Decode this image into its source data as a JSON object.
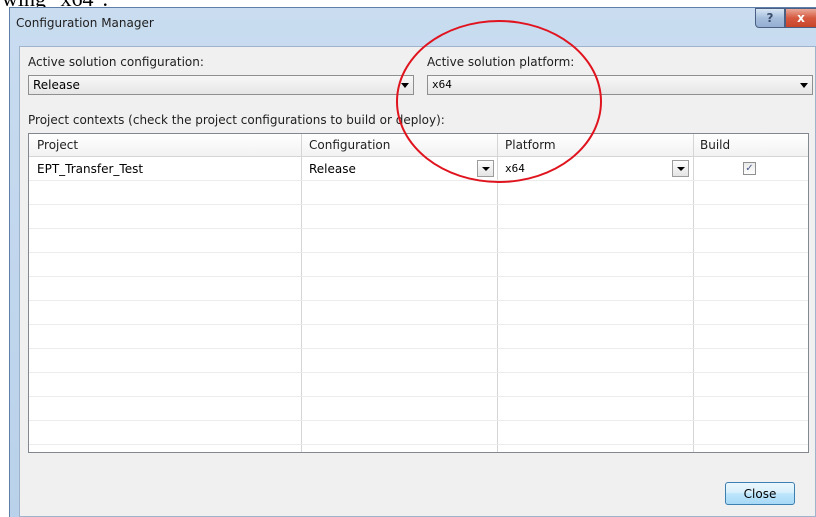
{
  "page_text": "wing \"x64\".",
  "window": {
    "title": "Configuration Manager",
    "help_glyph": "?",
    "close_glyph": "x"
  },
  "active_config": {
    "label": "Active solution configuration:",
    "value": "Release"
  },
  "active_platform": {
    "label": "Active solution platform:",
    "value": "x64"
  },
  "contexts_label": "Project contexts (check the project configurations to build or deploy):",
  "grid": {
    "headers": [
      "Project",
      "Configuration",
      "Platform",
      "Build"
    ],
    "rows": [
      {
        "project": "EPT_Transfer_Test",
        "configuration": "Release",
        "platform": "x64",
        "build_mark": "✓",
        "build_checked": true
      }
    ]
  },
  "close_button_label": "Close",
  "annotation_color": "#e0141e"
}
